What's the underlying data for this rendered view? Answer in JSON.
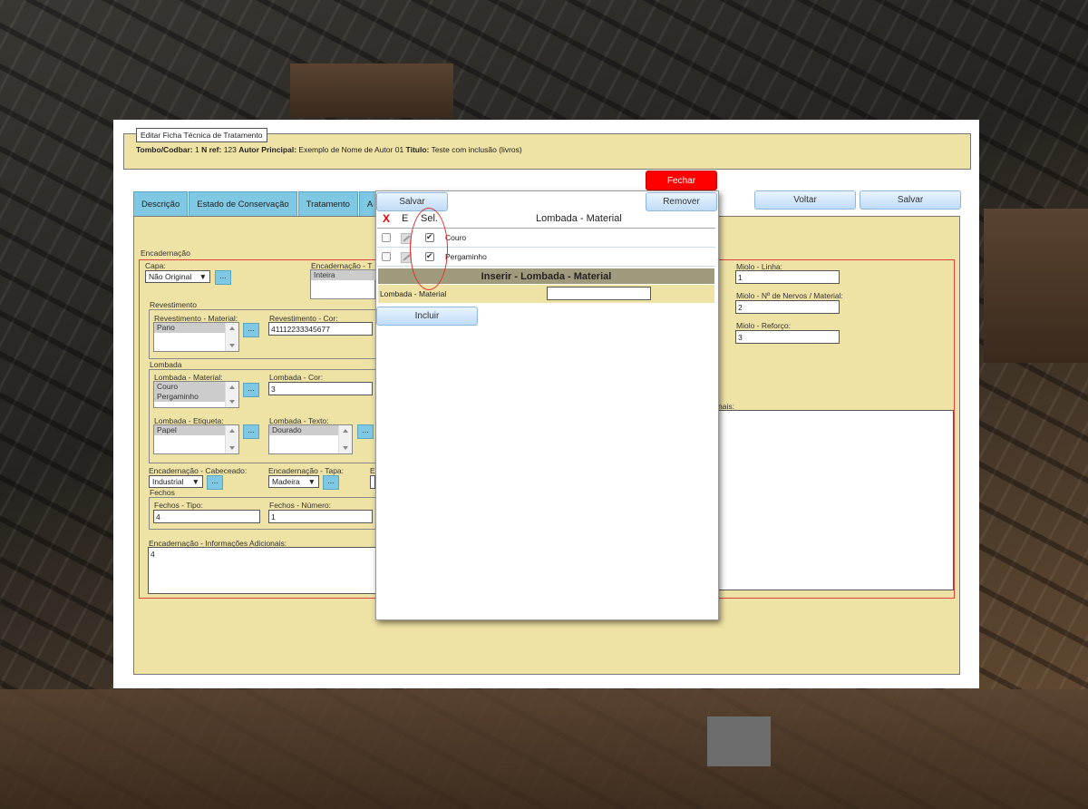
{
  "header": {
    "legend": "Editar Ficha Técnica de Tratamento",
    "tombo_label": "Tombo/Codbar:",
    "tombo_value": "1",
    "nref_label": "N ref:",
    "nref_value": "123",
    "autor_label": "Autor Principal:",
    "autor_value": "Exemplo de Nome de Autor 01",
    "titulo_label": "Titulo:",
    "titulo_value": "Teste com inclusão (livros)"
  },
  "buttons": {
    "fechar": "Fechar",
    "remover": "Remover",
    "voltar": "Voltar",
    "salvar": "Salvar",
    "modal_salvar": "Salvar",
    "incluir": "Incluir",
    "dots": "..."
  },
  "tabs": [
    "Descrição",
    "Estado de Conservação",
    "Tratamento",
    "A"
  ],
  "form": {
    "encadernacao": "Encadernação",
    "capa_label": "Capa:",
    "capa_value": "Não Original",
    "enc_tipo_label": "Encadernação - T",
    "enc_tipo_value": "Inteira",
    "revestimento": "Revestimento",
    "rev_material_label": "Revestimento - Material:",
    "rev_material_items": [
      "Pano"
    ],
    "rev_cor_label": "Revestimento - Cor:",
    "rev_cor_value": "41112233345677",
    "lombada": "Lombada",
    "lomb_material_label": "Lombada - Material:",
    "lomb_material_items": [
      "Couro",
      "Pergaminho"
    ],
    "lomb_cor_label": "Lombada - Cor:",
    "lomb_cor_value": "3",
    "lomb_etiqueta_label": "Lombada - Etiqueta:",
    "lomb_etiqueta_items": [
      "Papel"
    ],
    "lomb_texto_label": "Lombada - Texto:",
    "lomb_texto_items": [
      "Dourado"
    ],
    "cabeceado_label": "Encadernação - Cabeceado:",
    "cabeceado_value": "Industrial",
    "tapa_label": "Encadernação - Tapa:",
    "tapa_value": "Madeira",
    "e_label": "E",
    "fechos": "Fechos",
    "fechos_tipo_label": "Fechos - Tipo:",
    "fechos_tipo_value": "4",
    "fechos_numero_label": "Fechos - Número:",
    "fechos_numero_value": "1",
    "info_label": "Encadernação - Informações Adicionais:",
    "info_value": "4",
    "miolo_linha_label": "Miolo - Linha:",
    "miolo_linha_value": "1",
    "miolo_nervos_label": "Miolo - Nº de Nervos / Material:",
    "miolo_nervos_value": "2",
    "miolo_reforco_label": "Miolo - Reforço:",
    "miolo_reforco_value": "3",
    "right_label_fragment": "nais:"
  },
  "modal": {
    "col_x": "X",
    "col_e": "E",
    "col_sel": "Sel.",
    "col_title": "Lombada - Material",
    "rows": [
      {
        "name": "Couro",
        "selected": true
      },
      {
        "name": "Pergaminho",
        "selected": true
      }
    ],
    "insert_title": "Inserir - Lombada - Material",
    "insert_label": "Lombada - Material",
    "insert_value": ""
  },
  "colors": {
    "accent_red": "#ff0000",
    "panel_beige": "#efe2a5",
    "tab_blue": "#7ec8e3"
  }
}
